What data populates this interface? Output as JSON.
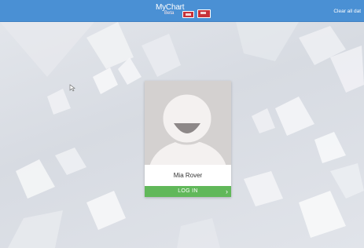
{
  "header": {
    "brand_name": "MyChart",
    "brand_sub": "Beta",
    "clear_all_label": "Clear all dat",
    "bar_color": "#4a90d4"
  },
  "login_card": {
    "user_name": "Mia Rover",
    "login_label": "LOG IN",
    "chevron": "›",
    "login_color": "#61b85a",
    "avatar_icon": "default-person-avatar-icon"
  }
}
